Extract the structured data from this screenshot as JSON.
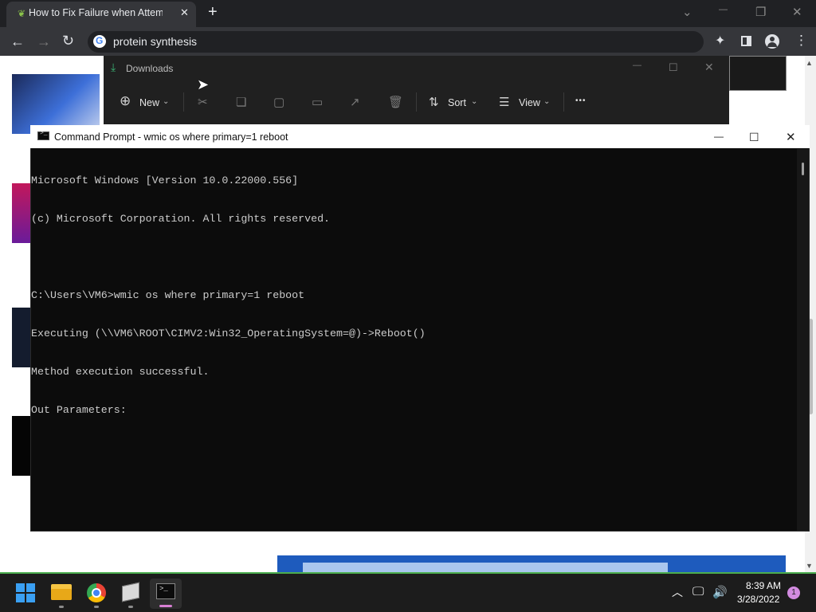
{
  "browser": {
    "tab_title": "How to Fix Failure when Attempting",
    "new_tab": "+",
    "address": "protein synthesis",
    "window_controls": {
      "collapse": "⌄",
      "minimize": "—",
      "restore": "❐",
      "close": "✕"
    }
  },
  "explorer": {
    "title": "Downloads",
    "toolbar": {
      "new": "New",
      "sort": "Sort",
      "view": "View",
      "more": "•••"
    }
  },
  "cmd": {
    "title": "Command Prompt - wmic  os where primary=1 reboot",
    "lines": [
      "Microsoft Windows [Version 10.0.22000.556]",
      "(c) Microsoft Corporation. All rights reserved.",
      "",
      "C:\\Users\\VM6>wmic os where primary=1 reboot",
      "Executing (\\\\VM6\\ROOT\\CIMV2:Win32_OperatingSystem=@)->Reboot()",
      "Method execution successful.",
      "Out Parameters:"
    ]
  },
  "taskbar": {
    "time": "8:39 AM",
    "date": "3/28/2022",
    "notification_count": "1"
  },
  "colors": {
    "taskbar_accent": "#4cae4f",
    "cmd_bg": "#0c0c0c",
    "chrome_bg": "#202124"
  }
}
